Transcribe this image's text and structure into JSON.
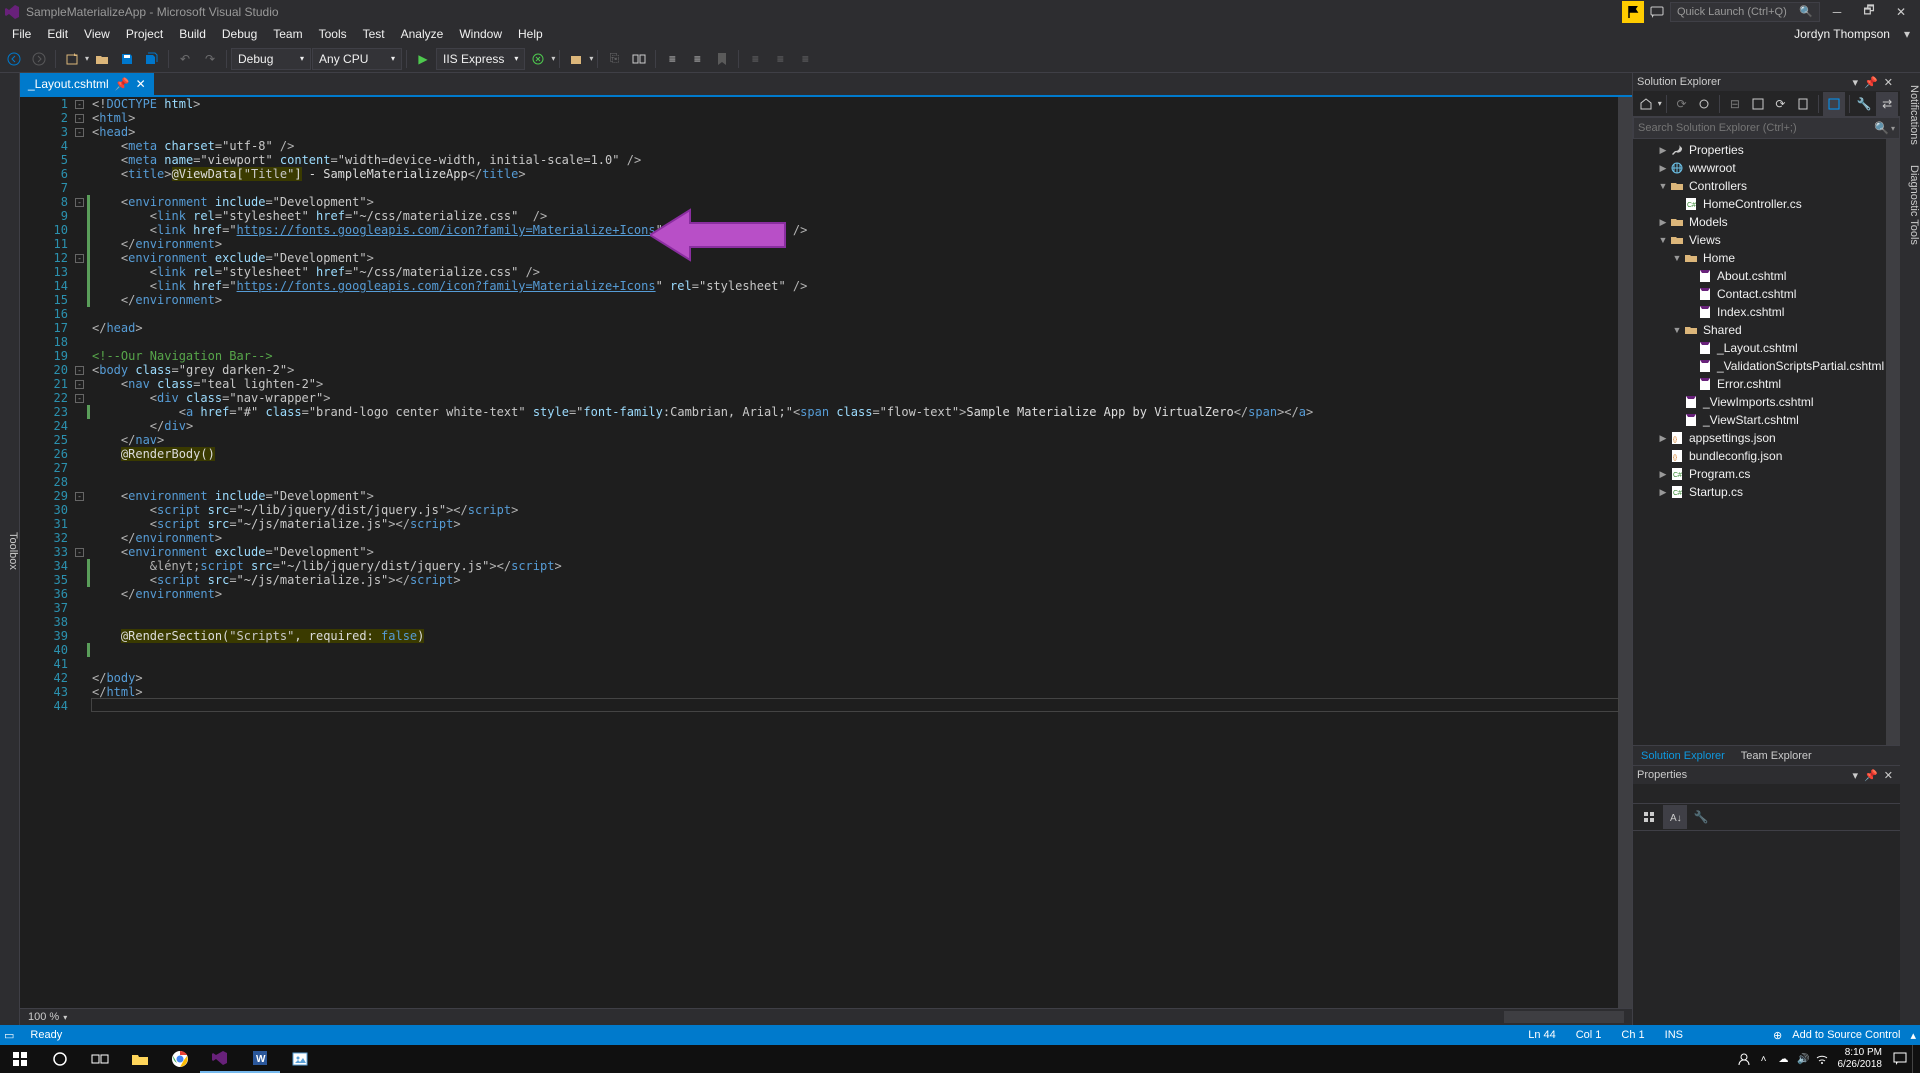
{
  "window": {
    "title": "SampleMaterializeApp - Microsoft Visual Studio",
    "quick_launch_placeholder": "Quick Launch (Ctrl+Q)"
  },
  "menu": {
    "items": [
      "File",
      "Edit",
      "View",
      "Project",
      "Build",
      "Debug",
      "Team",
      "Tools",
      "Test",
      "Analyze",
      "Window",
      "Help"
    ],
    "user": "Jordyn Thompson"
  },
  "toolbar": {
    "config": "Debug",
    "platform": "Any CPU",
    "run": "IIS Express"
  },
  "tab": {
    "name": "_Layout.cshtml"
  },
  "zoom": "100 %",
  "status": {
    "ready": "Ready",
    "line": "Ln 44",
    "col": "Col 1",
    "ch": "Ch 1",
    "ins": "INS",
    "source_control": "Add to Source Control"
  },
  "solution_explorer": {
    "title": "Solution Explorer",
    "search_placeholder": "Search Solution Explorer (Ctrl+;)",
    "tree": [
      {
        "indent": 1,
        "arrow": "▶",
        "icon": "wrench",
        "label": "Properties"
      },
      {
        "indent": 1,
        "arrow": "▶",
        "icon": "globe",
        "label": "wwwroot"
      },
      {
        "indent": 1,
        "arrow": "▼",
        "icon": "folder",
        "label": "Controllers"
      },
      {
        "indent": 2,
        "arrow": "",
        "icon": "cs",
        "label": "HomeController.cs"
      },
      {
        "indent": 1,
        "arrow": "▶",
        "icon": "folder",
        "label": "Models"
      },
      {
        "indent": 1,
        "arrow": "▼",
        "icon": "folder",
        "label": "Views"
      },
      {
        "indent": 2,
        "arrow": "▼",
        "icon": "folder",
        "label": "Home"
      },
      {
        "indent": 3,
        "arrow": "",
        "icon": "cshtml",
        "label": "About.cshtml"
      },
      {
        "indent": 3,
        "arrow": "",
        "icon": "cshtml",
        "label": "Contact.cshtml"
      },
      {
        "indent": 3,
        "arrow": "",
        "icon": "cshtml",
        "label": "Index.cshtml"
      },
      {
        "indent": 2,
        "arrow": "▼",
        "icon": "folder",
        "label": "Shared"
      },
      {
        "indent": 3,
        "arrow": "",
        "icon": "cshtml",
        "label": "_Layout.cshtml"
      },
      {
        "indent": 3,
        "arrow": "",
        "icon": "cshtml",
        "label": "_ValidationScriptsPartial.cshtml"
      },
      {
        "indent": 3,
        "arrow": "",
        "icon": "cshtml",
        "label": "Error.cshtml"
      },
      {
        "indent": 2,
        "arrow": "",
        "icon": "cshtml",
        "label": "_ViewImports.cshtml"
      },
      {
        "indent": 2,
        "arrow": "",
        "icon": "cshtml",
        "label": "_ViewStart.cshtml"
      },
      {
        "indent": 1,
        "arrow": "▶",
        "icon": "json",
        "label": "appsettings.json"
      },
      {
        "indent": 1,
        "arrow": "",
        "icon": "json",
        "label": "bundleconfig.json"
      },
      {
        "indent": 1,
        "arrow": "▶",
        "icon": "cs",
        "label": "Program.cs"
      },
      {
        "indent": 1,
        "arrow": "▶",
        "icon": "cs",
        "label": "Startup.cs"
      }
    ],
    "tabs": [
      "Solution Explorer",
      "Team Explorer"
    ]
  },
  "properties": {
    "title": "Properties"
  },
  "side_tabs": {
    "left": "Toolbox",
    "right_top": "Notifications",
    "right_bottom": "Diagnostic Tools"
  },
  "code": {
    "lines": [
      {
        "n": 1,
        "fold": "-",
        "html": "<span class='c-op'>&lt;!</span><span class='c-tag'>DOCTYPE</span> <span class='c-attr'>html</span><span class='c-op'>&gt;</span>"
      },
      {
        "n": 2,
        "fold": "-",
        "html": "<span class='c-op'>&lt;</span><span class='c-tag'>html</span><span class='c-op'>&gt;</span>"
      },
      {
        "n": 3,
        "fold": "-",
        "html": "<span class='c-op'>&lt;</span><span class='c-tag'>head</span><span class='c-op'>&gt;</span>"
      },
      {
        "n": 4,
        "html": "    <span class='c-op'>&lt;</span><span class='c-tag'>meta</span> <span class='c-attr'>charset</span><span class='c-op'>=</span><span class='c-str'>\"utf-8\"</span> <span class='c-op'>/&gt;</span>"
      },
      {
        "n": 5,
        "html": "    <span class='c-op'>&lt;</span><span class='c-tag'>meta</span> <span class='c-attr'>name</span><span class='c-op'>=</span><span class='c-str'>\"viewport\"</span> <span class='c-attr'>content</span><span class='c-op'>=</span><span class='c-str'>\"width=device-width, initial-scale=1.0\"</span> <span class='c-op'>/&gt;</span>"
      },
      {
        "n": 6,
        "html": "    <span class='c-op'>&lt;</span><span class='c-tag'>title</span><span class='c-op'>&gt;</span><span class='c-razor'>@ViewData[<span class='c-str'>\"Title\"</span>]</span> - SampleMaterializeApp<span class='c-op'>&lt;/</span><span class='c-tag'>title</span><span class='c-op'>&gt;</span>"
      },
      {
        "n": 7,
        "html": ""
      },
      {
        "n": 8,
        "fold": "-",
        "bar": "green",
        "html": "    <span class='c-op'>&lt;</span><span class='c-tag'>environment</span> <span class='c-attr'>include</span><span class='c-op'>=</span><span class='c-str'>\"Development\"</span><span class='c-op'>&gt;</span>"
      },
      {
        "n": 9,
        "bar": "green",
        "html": "        <span class='c-op'>&lt;</span><span class='c-tag'>link</span> <span class='c-attr'>rel</span><span class='c-op'>=</span><span class='c-str'>\"stylesheet\"</span> <span class='c-attr'>href</span><span class='c-op'>=</span><span class='c-str'>\"~/css/materialize.css\"</span>  <span class='c-op'>/&gt;</span>"
      },
      {
        "n": 10,
        "bar": "green",
        "html": "        <span class='c-op'>&lt;</span><span class='c-tag'>link</span> <span class='c-attr'>href</span><span class='c-op'>=</span><span class='c-str'>\"<span class='c-url'>https://fonts.googleapis.com/icon?family=Materialize+Icons</span>\"</span> <span class='c-attr'>rel</span><span class='c-op'>=</span><span class='c-str'>\"stylesheet\"</span> <span class='c-op'>/&gt;</span>"
      },
      {
        "n": 11,
        "bar": "green",
        "html": "    <span class='c-op'>&lt;/</span><span class='c-tag'>environment</span><span class='c-op'>&gt;</span>"
      },
      {
        "n": 12,
        "fold": "-",
        "bar": "green",
        "html": "    <span class='c-op'>&lt;</span><span class='c-tag'>environment</span> <span class='c-attr'>exclude</span><span class='c-op'>=</span><span class='c-str'>\"Development\"</span><span class='c-op'>&gt;</span>"
      },
      {
        "n": 13,
        "bar": "green",
        "html": "        <span class='c-op'>&lt;</span><span class='c-tag'>link</span> <span class='c-attr'>rel</span><span class='c-op'>=</span><span class='c-str'>\"stylesheet\"</span> <span class='c-attr'>href</span><span class='c-op'>=</span><span class='c-str'>\"~/css/materialize.css\"</span> <span class='c-op'>/&gt;</span>"
      },
      {
        "n": 14,
        "bar": "green",
        "html": "        <span class='c-op'>&lt;</span><span class='c-tag'>link</span> <span class='c-attr'>href</span><span class='c-op'>=</span><span class='c-str'>\"<span class='c-url'>https://fonts.googleapis.com/icon?family=Materialize+Icons</span>\"</span> <span class='c-attr'>rel</span><span class='c-op'>=</span><span class='c-str'>\"stylesheet\"</span> <span class='c-op'>/&gt;</span>"
      },
      {
        "n": 15,
        "bar": "green",
        "html": "    <span class='c-op'>&lt;/</span><span class='c-tag'>environment</span><span class='c-op'>&gt;</span>"
      },
      {
        "n": 16,
        "html": ""
      },
      {
        "n": 17,
        "html": "<span class='c-op'>&lt;/</span><span class='c-tag'>head</span><span class='c-op'>&gt;</span>"
      },
      {
        "n": 18,
        "html": ""
      },
      {
        "n": 19,
        "html": "<span class='c-comment'>&lt;!--Our Navigation Bar--&gt;</span>"
      },
      {
        "n": 20,
        "fold": "-",
        "html": "<span class='c-op'>&lt;</span><span class='c-tag'>body</span> <span class='c-attr'>class</span><span class='c-op'>=</span><span class='c-str'>\"grey darken-2\"</span><span class='c-op'>&gt;</span>"
      },
      {
        "n": 21,
        "fold": "-",
        "html": "    <span class='c-op'>&lt;</span><span class='c-tag'>nav</span> <span class='c-attr'>class</span><span class='c-op'>=</span><span class='c-str'>\"teal lighten-2\"</span><span class='c-op'>&gt;</span>"
      },
      {
        "n": 22,
        "fold": "-",
        "html": "        <span class='c-op'>&lt;</span><span class='c-tag'>div</span> <span class='c-attr'>class</span><span class='c-op'>=</span><span class='c-str'>\"nav-wrapper\"</span><span class='c-op'>&gt;</span>"
      },
      {
        "n": 23,
        "bar": "green",
        "html": "            <span class='c-op'>&lt;</span><span class='c-tag'>a</span> <span class='c-attr'>href</span><span class='c-op'>=</span><span class='c-str'>\"#\"</span> <span class='c-attr'>class</span><span class='c-op'>=</span><span class='c-str'>\"brand-logo center white-text\"</span> <span class='c-attr'>style</span><span class='c-op'>=</span><span class='c-str'>\"<span class='c-attr'>font-family</span>:Cambrian, Arial;\"</span><span class='c-op'>&lt;</span><span class='c-tag'>span</span> <span class='c-attr'>class</span><span class='c-op'>=</span><span class='c-str'>\"flow-text\"</span><span class='c-op'>&gt;</span>Sample Materialize App by VirtualZero<span class='c-op'>&lt;/</span><span class='c-tag'>span</span><span class='c-op'>&gt;&lt;/</span><span class='c-tag'>a</span><span class='c-op'>&gt;</span>"
      },
      {
        "n": 24,
        "html": "        <span class='c-op'>&lt;/</span><span class='c-tag'>div</span><span class='c-op'>&gt;</span>"
      },
      {
        "n": 25,
        "html": "    <span class='c-op'>&lt;/</span><span class='c-tag'>nav</span><span class='c-op'>&gt;</span>"
      },
      {
        "n": 26,
        "html": "    <span class='c-razor'>@RenderBody()</span>"
      },
      {
        "n": 27,
        "html": ""
      },
      {
        "n": 28,
        "html": ""
      },
      {
        "n": 29,
        "fold": "-",
        "html": "    <span class='c-op'>&lt;</span><span class='c-tag'>environment</span> <span class='c-attr'>include</span><span class='c-op'>=</span><span class='c-str'>\"Development\"</span><span class='c-op'>&gt;</span>"
      },
      {
        "n": 30,
        "html": "        <span class='c-op'>&lt;</span><span class='c-tag'>script</span> <span class='c-attr'>src</span><span class='c-op'>=</span><span class='c-str'>\"~/lib/jquery/dist/jquery.js\"</span><span class='c-op'>&gt;&lt;/</span><span class='c-tag'>script</span><span class='c-op'>&gt;</span>"
      },
      {
        "n": 31,
        "html": "        <span class='c-op'>&lt;</span><span class='c-tag'>script</span> <span class='c-attr'>src</span><span class='c-op'>=</span><span class='c-str'>\"~/js/materialize.js\"</span><span class='c-op'>&gt;&lt;/</span><span class='c-tag'>script</span><span class='c-op'>&gt;</span>"
      },
      {
        "n": 32,
        "html": "    <span class='c-op'>&lt;/</span><span class='c-tag'>environment</span><span class='c-op'>&gt;</span>"
      },
      {
        "n": 33,
        "fold": "-",
        "html": "    <span class='c-op'>&lt;</span><span class='c-tag'>environment</span> <span class='c-attr'>exclude</span><span class='c-op'>=</span><span class='c-str'>\"Development\"</span><span class='c-op'>&gt;</span>"
      },
      {
        "n": 34,
        "bar": "green",
        "html": "        <span class='c-op'>&lényt;</span><span class='c-tag'>script</span> <span class='c-attr'>src</span><span class='c-op'>=</span><span class='c-str'>\"~/lib/jquery/dist/jquery.js\"</span><span class='c-op'>&gt;&lt;/</span><span class='c-tag'>script</span><span class='c-op'>&gt;</span>"
      },
      {
        "n": 35,
        "bar": "green",
        "html": "        <span class='c-op'>&lt;</span><span class='c-tag'>script</span> <span class='c-attr'>src</span><span class='c-op'>=</span><span class='c-str'>\"~/js/materialize.js\"</span><span class='c-op'>&gt;&lt;/</span><span class='c-tag'>script</span><span class='c-op'>&gt;</span>"
      },
      {
        "n": 36,
        "html": "    <span class='c-op'>&lt;/</span><span class='c-tag'>environment</span><span class='c-op'>&gt;</span>"
      },
      {
        "n": 37,
        "html": ""
      },
      {
        "n": 38,
        "html": ""
      },
      {
        "n": 39,
        "html": "    <span class='c-razor'>@RenderSection(<span class='c-str'>\"Scripts\"</span>, required: <span class='c-keyword'>false</span>)</span>"
      },
      {
        "n": 40,
        "bar": "green",
        "html": ""
      },
      {
        "n": 41,
        "html": ""
      },
      {
        "n": 42,
        "html": "<span class='c-op'>&lt;/</span><span class='c-tag'>body</span><span class='c-op'>&gt;</span>"
      },
      {
        "n": 43,
        "html": "<span class='c-op'>&lt;/</span><span class='c-tag'>html</span><span class='c-op'>&gt;</span>"
      },
      {
        "n": 44,
        "cursor": true,
        "html": ""
      }
    ]
  },
  "taskbar": {
    "time": "8:10 PM",
    "date": "6/26/2018"
  }
}
